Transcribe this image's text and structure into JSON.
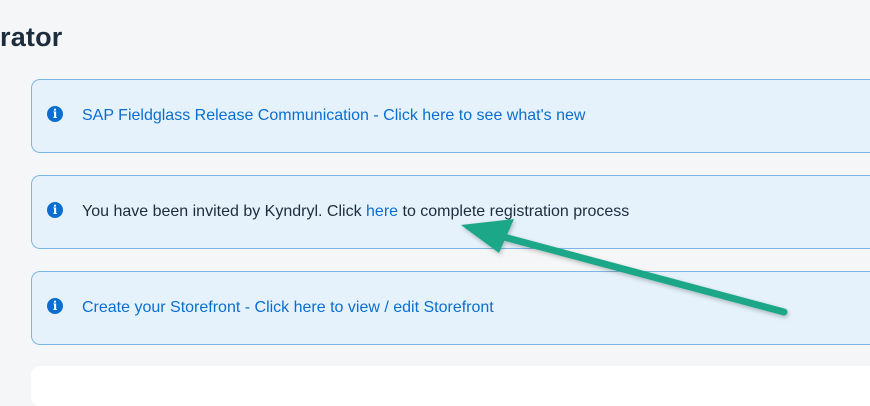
{
  "header": {
    "title": "rator"
  },
  "messages": [
    {
      "icon": "info-icon",
      "link_text": "SAP Fieldglass Release Communication - Click here to see what's new"
    },
    {
      "icon": "info-icon",
      "text_before": "You have been invited by Kyndryl. Click ",
      "link_text": "here",
      "text_after": " to complete registration process"
    },
    {
      "icon": "info-icon",
      "link_text": "Create your Storefront - Click here to view / edit Storefront"
    }
  ],
  "annotation": {
    "icon": "arrow-icon",
    "color": "#1ea888"
  },
  "colors": {
    "link": "#0a6ed1",
    "strip_background": "#e5f2fb",
    "strip_border": "#7db7e6",
    "page_background": "#f5f6f7"
  }
}
